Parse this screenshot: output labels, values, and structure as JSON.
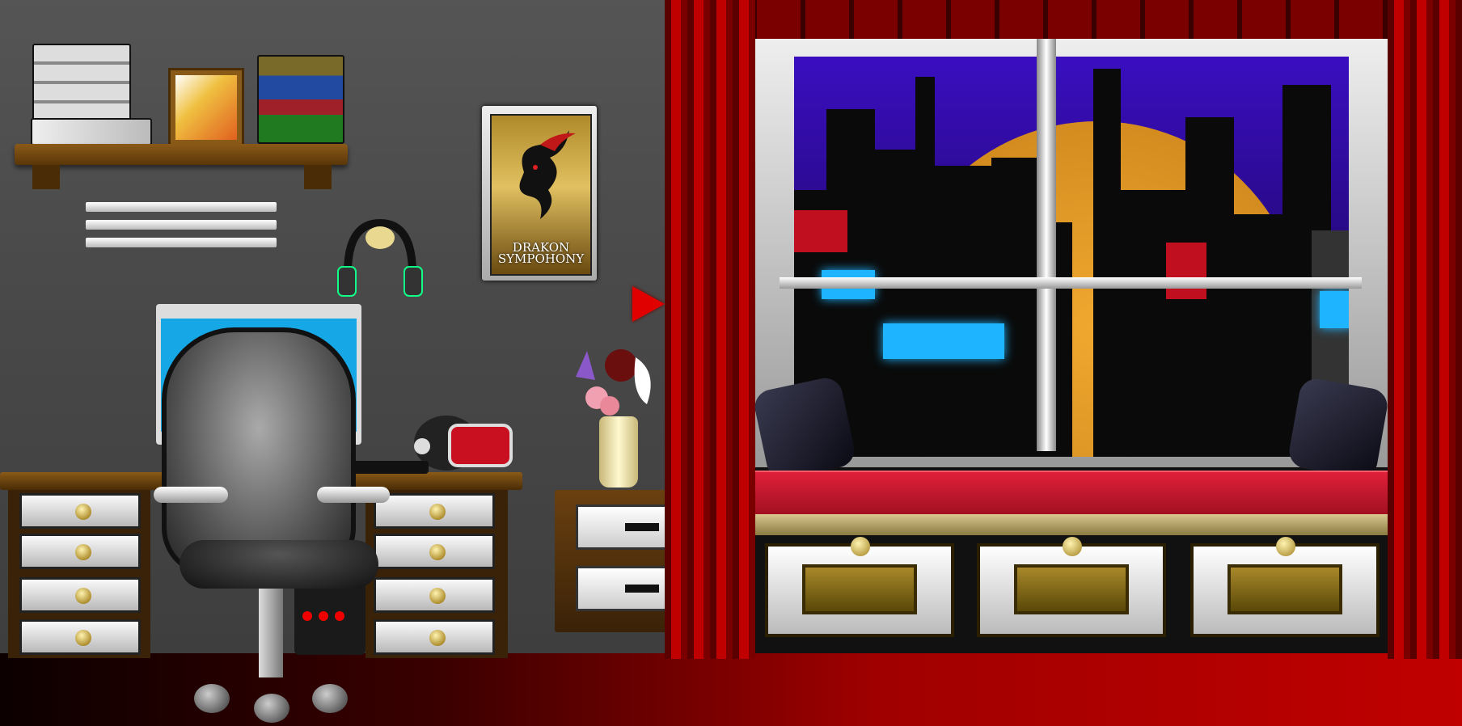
{
  "scene": {
    "poster": {
      "title": "DRAKON\nSYMPOHONY"
    },
    "colors": {
      "wall": "#4a4a4a",
      "floor": "#c00000",
      "curtain": "#c00000",
      "monitor_screen": "#15a7e6",
      "sky": "#2a0a8c",
      "sun": "#e09a28",
      "cushion": "#d01830",
      "city_glow": "#1fb4ff"
    },
    "objects": [
      "bookshelf",
      "picture-frame",
      "wall-vent",
      "headphones-icon",
      "dragon-poster",
      "desk",
      "monitor",
      "gaming-chair",
      "vr-headset",
      "flower-vase",
      "nightstand",
      "window",
      "city-skyline",
      "window-seat",
      "storage-cabinet",
      "cursor-arrow-icon"
    ]
  }
}
